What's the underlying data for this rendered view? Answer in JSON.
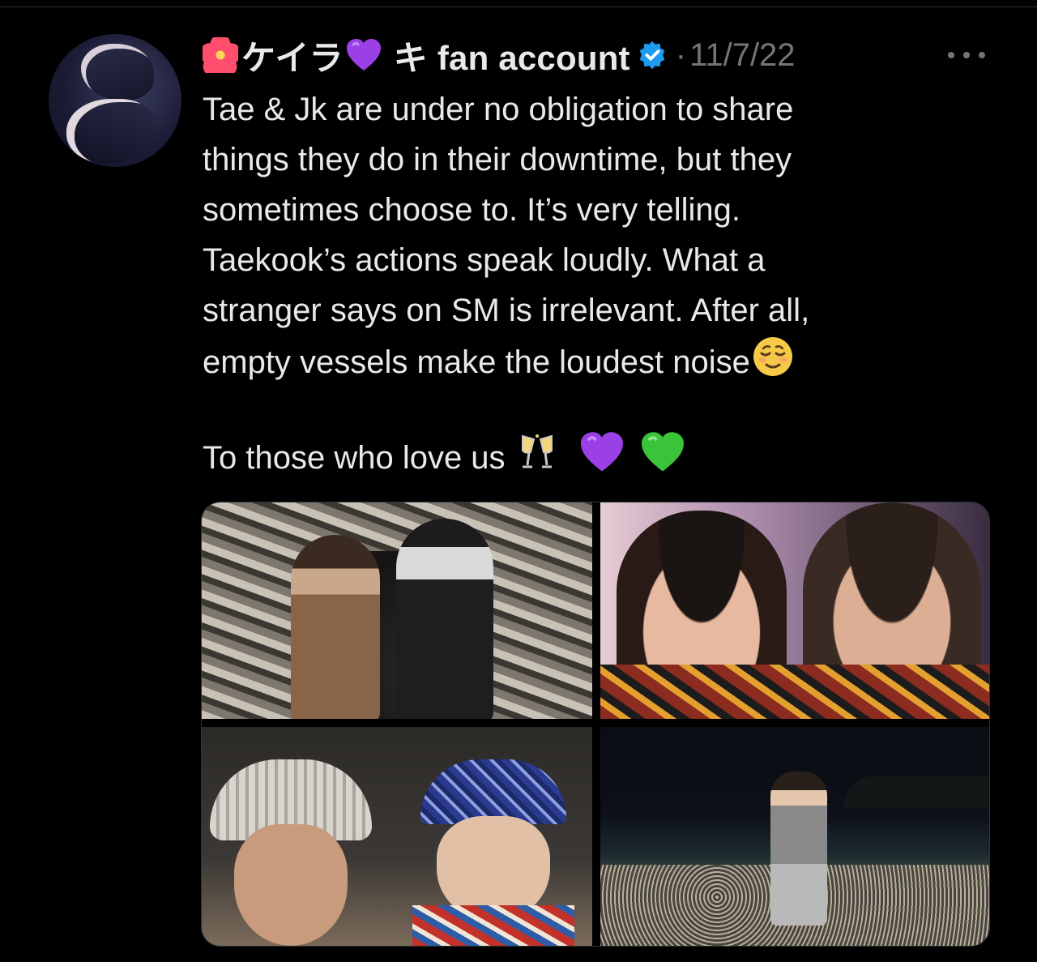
{
  "tweet": {
    "author": {
      "name_prefix_emoji": "hibiscus",
      "name_jp": "ケイラ",
      "name_heart_emoji": "purple-heart",
      "name_tail": "キ fan account",
      "verified": true,
      "avatar_alt": ""
    },
    "separator": "·",
    "date": "11/7/22",
    "text_line_block": "Tae & Jk are under no obligation to share\nthings they do in their downtime, but they\nsometimes choose to. It’s very telling.\nTaekook’s actions speak loudly. What a\nstranger says on SM is irrelevant. After all,\nempty vessels make the loudest noise",
    "text_trailing_emoji": "relieved-face",
    "text_second_paragraph": "To those who love us",
    "text_second_emojis": [
      "clinking-glasses",
      "purple-heart",
      "green-heart"
    ],
    "media_count": 4,
    "media": [
      {
        "name": "photo-mirror-selfie"
      },
      {
        "name": "photo-closeup-wink"
      },
      {
        "name": "photo-hat-bandana"
      },
      {
        "name": "photo-night-beach"
      }
    ]
  },
  "colors": {
    "background": "#000000",
    "text_primary": "#e7e9ea",
    "text_secondary": "#71767b",
    "verified_blue": "#1d9bf0",
    "heart_purple": "#9b3fe6",
    "heart_green": "#39c43a"
  },
  "icons": {
    "verified": "verified-badge-icon",
    "more": "more-options-icon"
  }
}
